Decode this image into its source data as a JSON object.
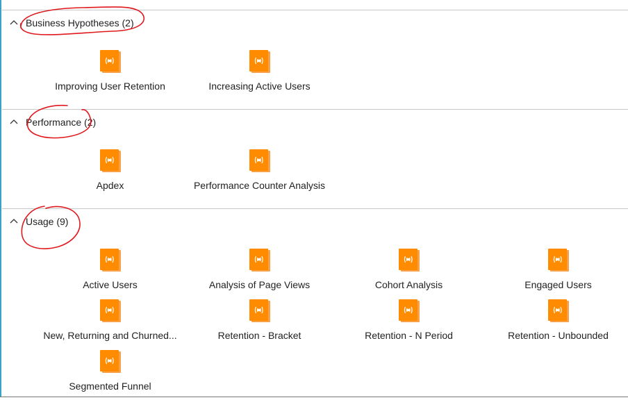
{
  "colors": {
    "accent_orange": "#ff8c00",
    "annotation_red": "#e0181e",
    "divider": "#c8c8c8",
    "left_rule": "#37a3c6"
  },
  "icons": {
    "tile": "workbook-book-icon",
    "toggle": "chevron-up-icon"
  },
  "sections": [
    {
      "title": "Business Hypotheses (2)",
      "items": [
        {
          "label": "Improving User Retention"
        },
        {
          "label": "Increasing Active Users"
        }
      ]
    },
    {
      "title": "Performance (2)",
      "items": [
        {
          "label": "Apdex"
        },
        {
          "label": "Performance Counter Analysis"
        }
      ]
    },
    {
      "title": "Usage (9)",
      "items": [
        {
          "label": "Active Users"
        },
        {
          "label": "Analysis of Page Views"
        },
        {
          "label": "Cohort Analysis"
        },
        {
          "label": "Engaged Users"
        },
        {
          "label": "New, Returning and Churned..."
        },
        {
          "label": "Retention - Bracket"
        },
        {
          "label": "Retention - N Period"
        },
        {
          "label": "Retention - Unbounded"
        },
        {
          "label": "Segmented Funnel"
        }
      ]
    }
  ]
}
